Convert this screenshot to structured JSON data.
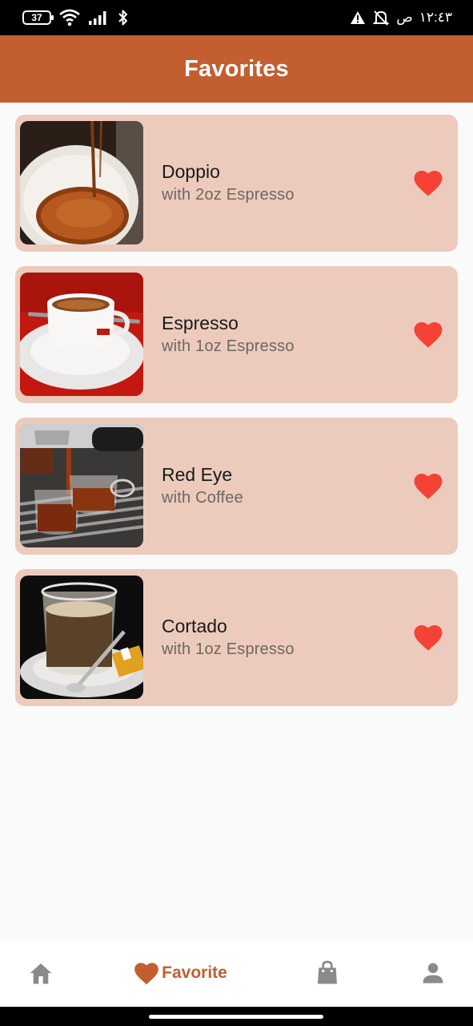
{
  "status_bar": {
    "battery_level": "37",
    "time": "١٢:٤٣",
    "period": "ص",
    "icons": [
      "battery-icon",
      "wifi-icon",
      "signal-icon",
      "bluetooth-icon",
      "warning-icon",
      "notifications-off-icon"
    ]
  },
  "app_bar": {
    "title": "Favorites",
    "color": "#c25e30"
  },
  "favorites": [
    {
      "title": "Doppio",
      "subtitle": "with 2oz Espresso",
      "image": "doppio-photo",
      "favorite_icon": "heart-icon"
    },
    {
      "title": "Espresso",
      "subtitle": "with 1oz Espresso",
      "image": "espresso-photo",
      "favorite_icon": "heart-icon"
    },
    {
      "title": "Red Eye",
      "subtitle": "with Coffee",
      "image": "red-eye-photo",
      "favorite_icon": "heart-icon"
    },
    {
      "title": "Cortado",
      "subtitle": "with 1oz Espresso",
      "image": "cortado-photo",
      "favorite_icon": "heart-icon"
    }
  ],
  "colors": {
    "accent": "#c25e30",
    "card_bg": "#eccbbd",
    "heart": "#f44336",
    "inactive_icon": "#8a8a8a"
  },
  "bottom_nav": {
    "items": [
      {
        "icon": "home-icon",
        "label": ""
      },
      {
        "icon": "heart-icon",
        "label": "Favorite"
      },
      {
        "icon": "shopping-bag-icon",
        "label": ""
      },
      {
        "icon": "person-icon",
        "label": ""
      }
    ],
    "selected": "Favorite"
  }
}
